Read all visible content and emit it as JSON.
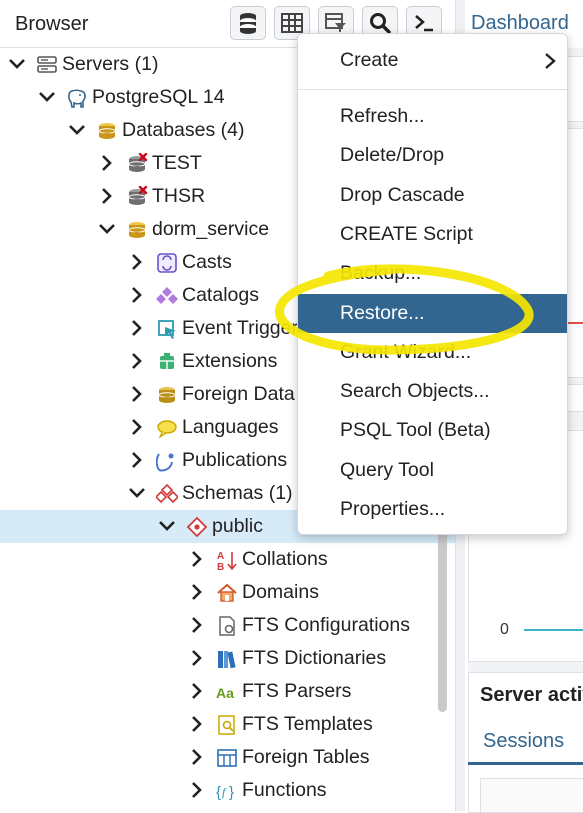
{
  "browser": {
    "title": "Browser",
    "toolbar": [
      {
        "name": "object-explorer-button",
        "icon": "database-stack-icon"
      },
      {
        "name": "table-view-button",
        "icon": "table-grid-icon"
      },
      {
        "name": "filtered-rows-button",
        "icon": "table-filter-icon"
      },
      {
        "name": "search-objects-button",
        "icon": "search-icon"
      },
      {
        "name": "psql-tool-button",
        "icon": "terminal-icon"
      }
    ],
    "tree": [
      {
        "label": "Servers (1)",
        "icon": "servers-icon",
        "expanded": true
      },
      {
        "label": "PostgreSQL 14",
        "icon": "postgresql-elephant-icon",
        "expanded": true
      },
      {
        "label": "Databases (4)",
        "icon": "databases-icon",
        "expanded": true
      },
      {
        "label": "TEST",
        "icon": "database-disconnected-icon",
        "expanded": false
      },
      {
        "label": "THSR",
        "icon": "database-disconnected-icon",
        "expanded": false
      },
      {
        "label": "dorm_service",
        "icon": "database-icon",
        "expanded": true
      },
      {
        "label": "Casts",
        "icon": "casts-icon",
        "expanded": false
      },
      {
        "label": "Catalogs",
        "icon": "catalogs-icon",
        "expanded": false
      },
      {
        "label": "Event Trigger",
        "icon": "event-trigger-icon",
        "expanded": false
      },
      {
        "label": "Extensions",
        "icon": "extensions-icon",
        "expanded": false
      },
      {
        "label": "Foreign Data",
        "icon": "foreign-data-icon",
        "expanded": false
      },
      {
        "label": "Languages",
        "icon": "languages-icon",
        "expanded": false
      },
      {
        "label": "Publications",
        "icon": "publications-icon",
        "expanded": false
      },
      {
        "label": "Schemas (1)",
        "icon": "schemas-icon",
        "expanded": true
      },
      {
        "label": "public",
        "icon": "schema-icon",
        "expanded": true,
        "selected": true
      },
      {
        "label": "Collations",
        "icon": "collations-icon",
        "expanded": false
      },
      {
        "label": "Domains",
        "icon": "domains-icon",
        "expanded": false
      },
      {
        "label": "FTS Configurations",
        "icon": "fts-configurations-icon",
        "expanded": false
      },
      {
        "label": "FTS Dictionaries",
        "icon": "fts-dictionaries-icon",
        "expanded": false
      },
      {
        "label": "FTS Parsers",
        "icon": "fts-parsers-icon",
        "expanded": false
      },
      {
        "label": "FTS Templates",
        "icon": "fts-templates-icon",
        "expanded": false
      },
      {
        "label": "Foreign Tables",
        "icon": "foreign-tables-icon",
        "expanded": false
      },
      {
        "label": "Functions",
        "icon": "functions-icon",
        "expanded": false
      }
    ]
  },
  "dashboard": {
    "tab_label": "Dashboard",
    "graph_zero": "0",
    "server_activity_title": "Server activ",
    "sessions_tab": "Sessions"
  },
  "context_menu": {
    "create_label": "Create",
    "items": [
      {
        "label": "Refresh...",
        "active": false
      },
      {
        "label": "Delete/Drop",
        "active": false
      },
      {
        "label": "Drop Cascade",
        "active": false
      },
      {
        "label": "CREATE Script",
        "active": false
      },
      {
        "label": "Backup...",
        "active": false
      },
      {
        "label": "Restore...",
        "active": true
      },
      {
        "label": "Grant Wizard...",
        "active": false
      },
      {
        "label": "Search Objects...",
        "active": false
      },
      {
        "label": "PSQL Tool (Beta)",
        "active": false
      },
      {
        "label": "Query Tool",
        "active": false
      },
      {
        "label": "Properties...",
        "active": false
      }
    ]
  },
  "colors": {
    "accent": "#326690",
    "selected_row": "#d6eaf8",
    "highlight_marker": "#f5e600"
  }
}
